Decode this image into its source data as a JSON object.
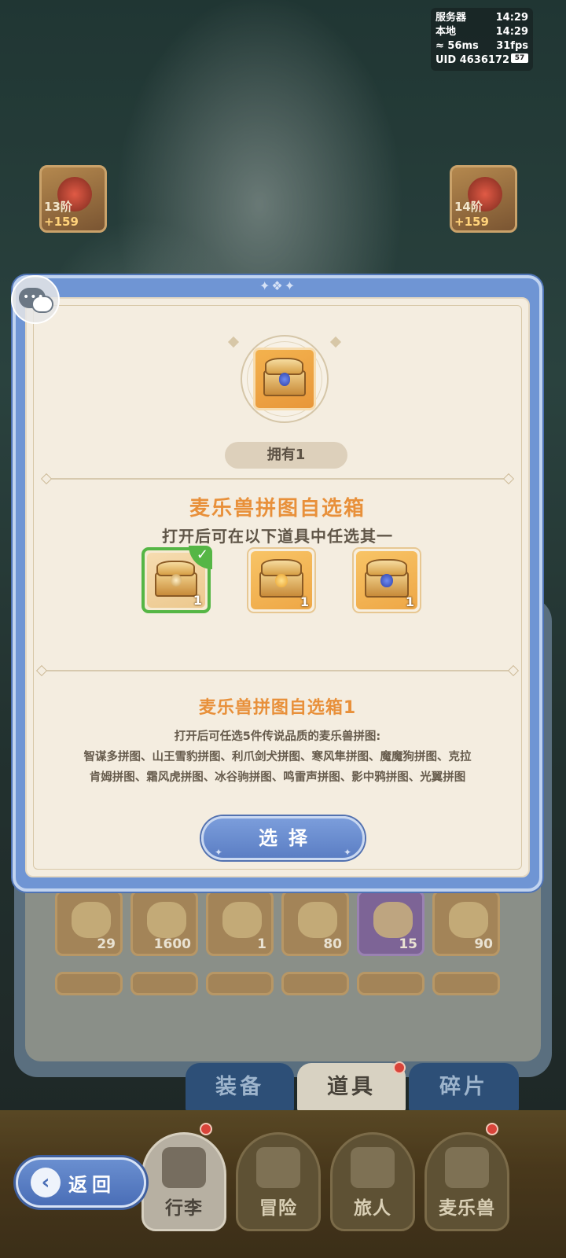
{
  "status_hud": {
    "server_label": "服务器",
    "server_time": "14:29",
    "local_label": "本地",
    "local_time": "14:29",
    "ping": "56ms",
    "fps": "31fps",
    "uid": "UID 4636172",
    "battery": "57"
  },
  "equipment_slots": [
    {
      "level": "13阶",
      "bonus": "+159"
    },
    {
      "level": "14阶",
      "bonus": "+159"
    }
  ],
  "bag_items_row1": [
    "29",
    "1600",
    "1",
    "80",
    "15",
    "90"
  ],
  "bag_tabs": [
    {
      "label": "装备",
      "active": false
    },
    {
      "label": "道具",
      "active": true
    },
    {
      "label": "碎片",
      "active": false
    }
  ],
  "nav": {
    "back": "返回",
    "items": [
      {
        "label": "行李",
        "active": true
      },
      {
        "label": "冒险",
        "active": false
      },
      {
        "label": "旅人",
        "active": false
      },
      {
        "label": "麦乐兽",
        "active": false
      }
    ]
  },
  "modal": {
    "owned": "拥有1",
    "title": "麦乐兽拼图自选箱",
    "subtitle": "打开后可在以下道具中任选其一",
    "choices": [
      {
        "count": "1",
        "icon": "harp-chest-icon",
        "selected": true
      },
      {
        "count": "1",
        "icon": "bell-chest-icon",
        "selected": false
      },
      {
        "count": "1",
        "icon": "gem-chest-icon",
        "selected": false
      }
    ],
    "detail_title": "麦乐兽拼图自选箱1",
    "detail_desc_lines": [
      "打开后可任选5件传说品质的麦乐兽拼图:",
      "智谋多拼图、山王雪豹拼图、利爪剑犬拼图、寒风隼拼图、魔魔狗拼图、克拉",
      "肯姆拼图、霜风虎拼图、冰谷驹拼图、鸣雷声拼图、影中鸦拼图、光翼拼图"
    ],
    "select_button": "选择"
  },
  "colors": {
    "accent_orange": "#e8903a",
    "modal_frame_blue": "#6f95d4",
    "selected_green": "#55b645",
    "panel_cream": "#f4ede0"
  }
}
